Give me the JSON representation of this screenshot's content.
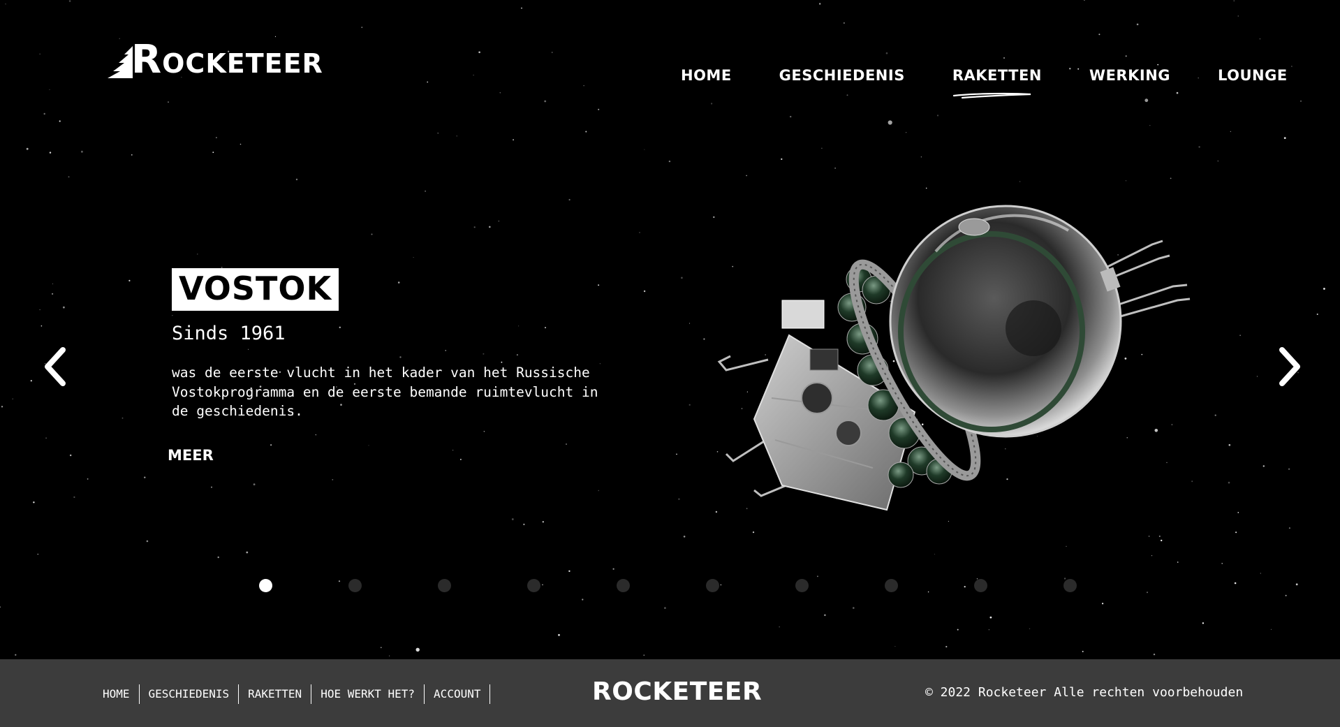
{
  "header": {
    "logo_text": "ROCKETEER",
    "nav": [
      {
        "label": "HOME",
        "active": false
      },
      {
        "label": "GESCHIEDENIS",
        "active": false
      },
      {
        "label": "RAKETTEN",
        "active": true
      },
      {
        "label": "WERKING",
        "active": false
      },
      {
        "label": "LOUNGE",
        "active": false
      }
    ]
  },
  "slide": {
    "title": "VOSTOK",
    "subtitle": "Sinds 1961",
    "description": "was de eerste vlucht in het kader van het Russische Vostokprogramma en de eerste bemande ruimtevlucht in de geschiedenis.",
    "more_label": "MEER",
    "image": "vostok-capsule"
  },
  "carousel": {
    "slide_count": 10,
    "active_index": 0,
    "prev_icon": "chevron-left-icon",
    "next_icon": "chevron-right-icon"
  },
  "footer": {
    "links": [
      "HOME",
      "GESCHIEDENIS",
      "RAKETTEN",
      "HOE WERKT HET?",
      "ACCOUNT"
    ],
    "logo_text": "ROCKETEER",
    "copyright": "© 2022 Rocketeer Alle rechten voorbehouden"
  },
  "colors": {
    "background": "#000000",
    "footer_background": "#3c3c3c",
    "text": "#ffffff",
    "dot_inactive": "#2b2b2b",
    "dot_active": "#ffffff"
  }
}
